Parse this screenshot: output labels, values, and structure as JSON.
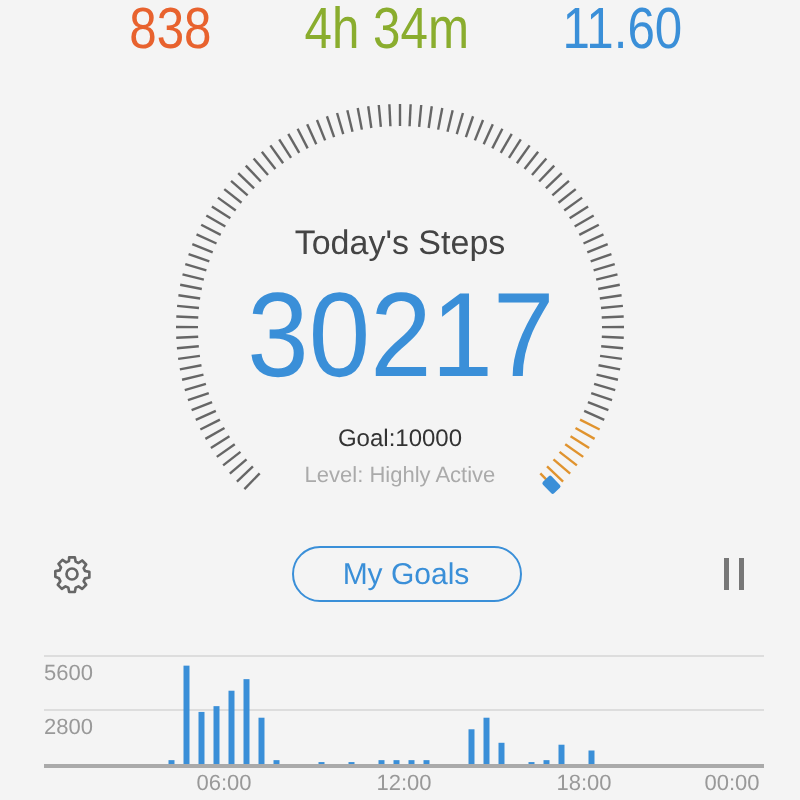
{
  "stats": [
    {
      "value": "838",
      "color": "#e8622e"
    },
    {
      "value": "4h 34m",
      "color": "#8aad2e"
    },
    {
      "value": "11.60",
      "color": "#3a8fd8"
    }
  ],
  "gauge": {
    "title": "Today's Steps",
    "steps": "30217",
    "goal": "Goal:10000",
    "activity": "Level: Highly Active"
  },
  "controls": {
    "goals_button": "My Goals"
  },
  "chart_data": {
    "type": "bar",
    "x": [
      0.25,
      0.75,
      1.25,
      1.75,
      2.25,
      2.75,
      3.25,
      3.75,
      4.25,
      4.75,
      5.25,
      5.75,
      6.25,
      6.75,
      7.25,
      7.75,
      8.25,
      8.75,
      9.25,
      9.75,
      10.25,
      10.75,
      11.25,
      11.75,
      12.25,
      12.75,
      13.25,
      13.75,
      14.25,
      14.75,
      15.25,
      15.75,
      16.25,
      16.75,
      17.25,
      17.75,
      18.25,
      18.75,
      19.25,
      19.75,
      20.25,
      20.75,
      21.25,
      21.75,
      22.25,
      22.75,
      23.25,
      23.75
    ],
    "series": [
      {
        "color": "#3a8fd8",
        "values": [
          0,
          0,
          0,
          0,
          0,
          0,
          0,
          0,
          200,
          5100,
          2700,
          3000,
          3800,
          4400,
          2400,
          200,
          0,
          0,
          100,
          0,
          100,
          0,
          200,
          200,
          200,
          200,
          0,
          0,
          1800,
          2400,
          1100,
          0,
          100,
          200,
          1000,
          0,
          700,
          0,
          0,
          0,
          0,
          0,
          0,
          0,
          0,
          0,
          0,
          0
        ]
      }
    ],
    "xlim": [
      0,
      24
    ],
    "ylim": [
      0,
      5600
    ],
    "yticks": [
      2800,
      5600
    ],
    "xticks": [
      {
        "value": 6,
        "label": "06:00"
      },
      {
        "value": 12,
        "label": "12:00"
      },
      {
        "value": 18,
        "label": "18:00"
      },
      {
        "value": 24,
        "label": "00:00"
      }
    ]
  }
}
